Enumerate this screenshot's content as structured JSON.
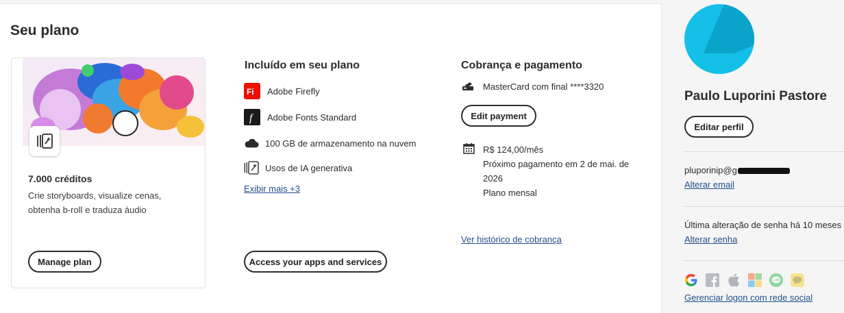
{
  "page": {
    "title": "Seu plano"
  },
  "plan_card": {
    "credits": "7.000 créditos",
    "description": "Crie storyboards, visualize cenas, obtenha b-roll e traduza áudio",
    "manage_label": "Manage plan"
  },
  "included": {
    "title": "Incluído em seu plano",
    "items": [
      {
        "label": "Adobe Firefly",
        "icon": "firefly-icon"
      },
      {
        "label": "Adobe Fonts Standard",
        "icon": "adobe-fonts-icon"
      },
      {
        "label": "100 GB de armazenamento na nuvem",
        "icon": "cloud-icon"
      },
      {
        "label": "Usos de IA generativa",
        "icon": "generative-ai-icon"
      }
    ],
    "show_more": "Exibir mais +3",
    "access_label": "Access your apps and services"
  },
  "billing": {
    "title": "Cobrança e pagamento",
    "card_text": "MasterCard com final ****3320",
    "edit_payment_label": "Edit payment",
    "price": "R$ 124,00/mês",
    "next_payment_line1": "Próximo pagamento em 2 de mai. de",
    "next_payment_line2": "2026",
    "plan_type": "Plano mensal",
    "history_link": "Ver histórico de cobrança"
  },
  "profile": {
    "name": "Paulo Luporini Pastore",
    "edit_label": "Editar perfil",
    "email_visible": "pluporinip@g",
    "change_email": "Alterar email",
    "password_status": "Última alteração de senha há 10 meses",
    "change_password": "Alterar senha",
    "social_icons": [
      "google-icon",
      "facebook-icon",
      "apple-icon",
      "microsoft-icon",
      "line-icon",
      "kakaotalk-icon"
    ],
    "manage_social": "Gerenciar logon com rede social"
  },
  "colors": {
    "firefly_red": "#eb1000",
    "link_blue": "#1f4e8c",
    "avatar_cyan": "#14c0e8"
  }
}
